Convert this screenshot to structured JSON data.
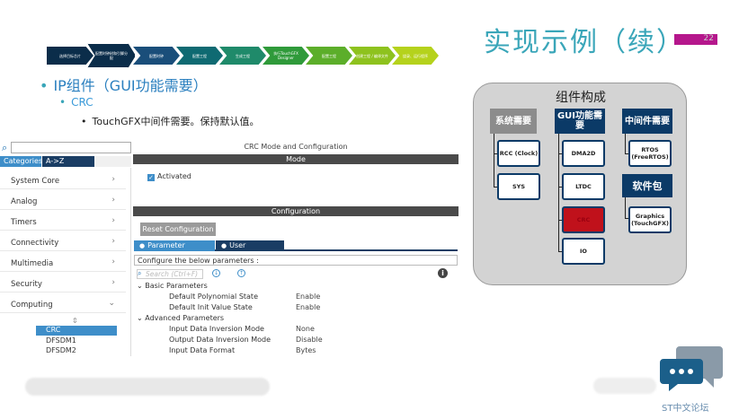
{
  "slide": {
    "title": "实现示例（续）",
    "page_number": "22",
    "bullet1": "IP组件（GUI功能需要）",
    "bullet2": "CRC",
    "bullet3_a": "TouchGFX",
    "bullet3_b": "中间件需要。保持默认值。"
  },
  "steps": [
    {
      "label": "选择目标芯片",
      "color": "#0b2d4a"
    },
    {
      "label": "配置时钟树和引脚分配",
      "color": "#0b2d4a"
    },
    {
      "label": "配置时钟",
      "color": "#1a4e7a"
    },
    {
      "label": "配置工程",
      "color": "#0f6a72"
    },
    {
      "label": "生成工程",
      "color": "#1f8a6a"
    },
    {
      "label": "执行TouchGFX Designer",
      "color": "#2f9a3a"
    },
    {
      "label": "配置工程",
      "color": "#5cae2a"
    },
    {
      "label": "创建工程 / 编译文件",
      "color": "#8ec21e"
    },
    {
      "label": "烧录、运行程序",
      "color": "#b5d21c"
    }
  ],
  "left_panel": {
    "search_placeholder": "",
    "tab_categories": "Categories",
    "tab_az": "A->Z",
    "categories": [
      {
        "label": "System Core",
        "chevron": "›"
      },
      {
        "label": "Analog",
        "chevron": "›"
      },
      {
        "label": "Timers",
        "chevron": "›"
      },
      {
        "label": "Connectivity",
        "chevron": "›"
      },
      {
        "label": "Multimedia",
        "chevron": "›"
      },
      {
        "label": "Security",
        "chevron": "›"
      },
      {
        "label": "Computing",
        "chevron": "⌄"
      }
    ],
    "updown": "⇕",
    "sub_items": [
      "CRC",
      "DFSDM1",
      "DFSDM2"
    ]
  },
  "right_panel": {
    "mode_config_title": "CRC Mode and Configuration",
    "mode_bar": "Mode",
    "activated_label": "Activated",
    "activated_check": "✓",
    "configuration_bar": "Configuration",
    "reset_button": "Reset Configuration",
    "tab_parameter_settings": "Parameter Settings",
    "tab_user_constants": "User Constants",
    "configure_label": "Configure the below parameters :",
    "search_placeholder": "Search (Ctrl+F)",
    "basic_group": "Basic Parameters",
    "advanced_group": "Advanced Parameters",
    "params": [
      {
        "name": "Default Polynomial State",
        "value": "Enable"
      },
      {
        "name": "Default Init Value State",
        "value": "Enable"
      },
      {
        "name": "Input Data Inversion Mode",
        "value": "None"
      },
      {
        "name": "Output Data Inversion Mode",
        "value": "Disable"
      },
      {
        "name": "Input Data Format",
        "value": "Bytes"
      }
    ]
  },
  "diagram": {
    "title": "组件构成",
    "col1_header": "系统需要",
    "col2_header": "GUI功能需要",
    "col3_header": "中间件需要",
    "col3b_header": "软件包",
    "rcc": "RCC (Clock)",
    "sys": "SYS",
    "dma2d": "DMA2D",
    "ltdc": "LTDC",
    "crc": "CRC",
    "io": "IO",
    "rtos": "RTOS (FreeRTOS)",
    "graphics": "Graphics (TouchGFX)"
  },
  "footer": {
    "forum_text": "ST中文论坛"
  },
  "colors": {
    "title": "#3aa6b9",
    "accent_pink": "#b5178c",
    "cube_blue": "#3e8ec9",
    "cube_navy": "#1a3d64",
    "diagram_navy": "#0b3a67",
    "crc_red": "#c0111b"
  }
}
